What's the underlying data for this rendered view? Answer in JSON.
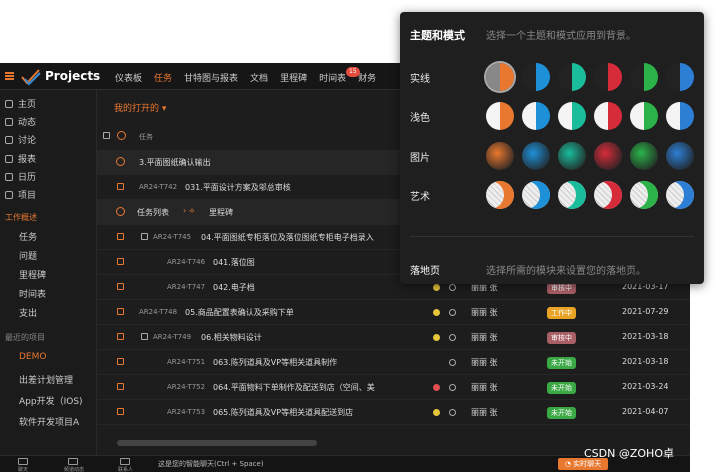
{
  "app": {
    "title": "Projects"
  },
  "nav": [
    "仪表板",
    "任务",
    "甘特图与报表",
    "文档",
    "里程碑",
    "时间表",
    "财务"
  ],
  "nav_badge": "15",
  "sidebar": {
    "items": [
      "主页",
      "动态",
      "讨论",
      "报表",
      "日历",
      "项目"
    ],
    "overview_head": "工作概述",
    "overview": [
      "任务",
      "问题",
      "里程碑",
      "时间表",
      "支出"
    ],
    "recent_head": "最近的项目",
    "projects": [
      "DEMO",
      "出差计划管理",
      "App开发（IOS)",
      "软件开发项目A"
    ]
  },
  "main": {
    "filter": "我的打开的",
    "col_task": "任务",
    "rows": [
      {
        "type": "section",
        "name": "3.平面图纸确认输出"
      },
      {
        "type": "task",
        "code": "AR24-T742",
        "name": "031.平面设计方案及邬总审核"
      },
      {
        "type": "section",
        "name": "任务列表",
        "extra": "里程碑"
      },
      {
        "type": "task",
        "code": "AR24-T745",
        "name": "04.平面图纸专柜落位及落位图纸专柜电子档录入",
        "icon": true
      },
      {
        "type": "task",
        "code": "AR24-T746",
        "name": "041.落位图",
        "indent": true
      },
      {
        "type": "task",
        "code": "AR24-T747",
        "name": "042.电子档",
        "indent": true,
        "owner": "丽丽 张",
        "status": "审核中",
        "date": "2021-03-17",
        "dot": "yellow"
      },
      {
        "type": "task",
        "code": "AR24-T748",
        "name": "05.商品配置表确认及采购下单",
        "owner": "丽丽 张",
        "status": "工作中",
        "date": "2021-07-29",
        "dot": "yellow"
      },
      {
        "type": "task",
        "code": "AR24-T749",
        "name": "06.相关物料设计",
        "icon": true,
        "owner": "丽丽 张",
        "status": "审核中",
        "date": "2021-03-18",
        "dot": "yellow"
      },
      {
        "type": "task",
        "code": "AR24-T751",
        "name": "063.陈列道具及VP等相关道具制作",
        "indent": true,
        "owner": "丽丽 张",
        "status": "未开始",
        "date": "2021-03-18",
        "dot": ""
      },
      {
        "type": "task",
        "code": "AR24-T752",
        "name": "064.平面物料下单制作及配送到店（空间、美",
        "indent": true,
        "owner": "丽丽 张",
        "status": "未开始",
        "date": "2021-03-24",
        "dot": "red"
      },
      {
        "type": "task",
        "code": "AR24-T753",
        "name": "065.陈列道具及VP等相关道具配送到店",
        "indent": true,
        "owner": "丽丽 张",
        "status": "未开始",
        "date": "2021-04-07",
        "dot": "yellow"
      }
    ]
  },
  "status_colors": {
    "审核中": "#a85f66",
    "工作中": "#e8a325",
    "未开始": "#3aa845"
  },
  "bottom": {
    "labels": [
      "聊天",
      "频道动态",
      "联系人"
    ],
    "hint": "这是您的智能聊天(Ctrl + Space)",
    "chat": "实时聊天"
  },
  "theme": {
    "title": "主题和模式",
    "desc": "选择一个主题和模式应用到背景。",
    "categories": [
      "实线",
      "浅色",
      "图片",
      "艺术"
    ],
    "colors": [
      "#e8782f",
      "#1e90d8",
      "#1abc9c",
      "#d62c3a",
      "#2bb34a",
      "#2d7fd6"
    ],
    "landing": "落地页",
    "landing_desc": "选择所需的模块来设置您的落地页。"
  },
  "watermark": "CSDN @ZOHO卓"
}
